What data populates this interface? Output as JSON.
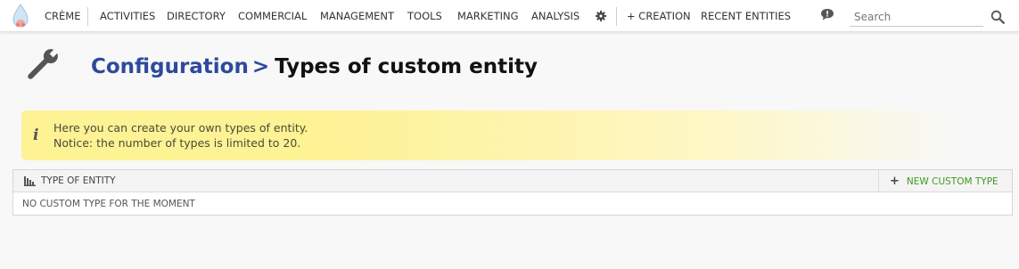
{
  "nav": {
    "brand": "Crème",
    "items": [
      "Activities",
      "Directory",
      "Commercial",
      "Management",
      "Tools",
      "Marketing",
      "Analysis"
    ],
    "creation": "+ Creation",
    "recent": "Recent entities",
    "search_placeholder": "Search"
  },
  "header": {
    "breadcrumb": "Configuration",
    "separator": ">",
    "title": "Types of custom entity"
  },
  "info": {
    "icon_glyph": "i",
    "line1": "Here you can create your own types of entity.",
    "line2": "Notice: the number of types is limited to 20."
  },
  "brick": {
    "title": "Type of entity",
    "action_plus": "+",
    "action_label": "New custom type",
    "empty": "No custom type for the moment"
  },
  "colors": {
    "link_blue": "#2e4a9c",
    "action_green": "#3d9a1f",
    "info_yellow": "#fdf294"
  },
  "icons": {
    "logo": "creme-logo-icon",
    "gear": "gear-icon",
    "notification": "speech-bubble-alert-icon",
    "search": "search-icon",
    "wrench": "wrench-icon",
    "info": "info-icon",
    "brick": "type-list-icon",
    "add": "plus-icon"
  }
}
